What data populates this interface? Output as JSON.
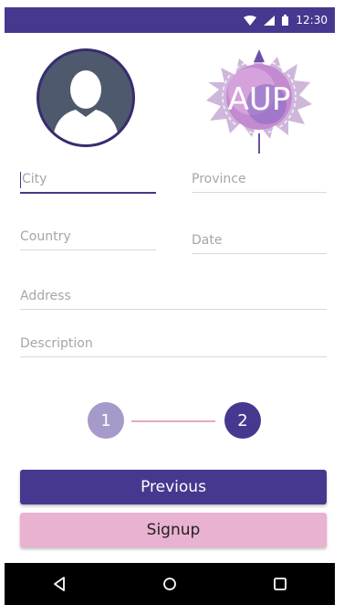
{
  "status_bar": {
    "time": "12:30",
    "icons": [
      "wifi-icon",
      "cell-signal-icon",
      "battery-icon"
    ]
  },
  "profile": {
    "avatar_icon": "user-silhouette-icon",
    "logo_text": "AUP"
  },
  "form": {
    "city": {
      "placeholder": "City",
      "value": ""
    },
    "province": {
      "placeholder": "Province",
      "value": ""
    },
    "country": {
      "placeholder": "Country",
      "value": ""
    },
    "date": {
      "placeholder": "Date",
      "value": ""
    },
    "address": {
      "placeholder": "Address",
      "value": ""
    },
    "description": {
      "placeholder": "Description",
      "value": ""
    }
  },
  "stepper": {
    "steps": [
      "1",
      "2"
    ],
    "current": 2
  },
  "buttons": {
    "previous": "Previous",
    "signup": "Signup"
  },
  "nav": {
    "icons": [
      "back-icon",
      "home-icon",
      "recents-icon"
    ]
  },
  "colors": {
    "primary": "#47388f",
    "accent": "#e8b2d0",
    "step_inactive": "#a59ac9",
    "connector": "#e6a9c2"
  }
}
